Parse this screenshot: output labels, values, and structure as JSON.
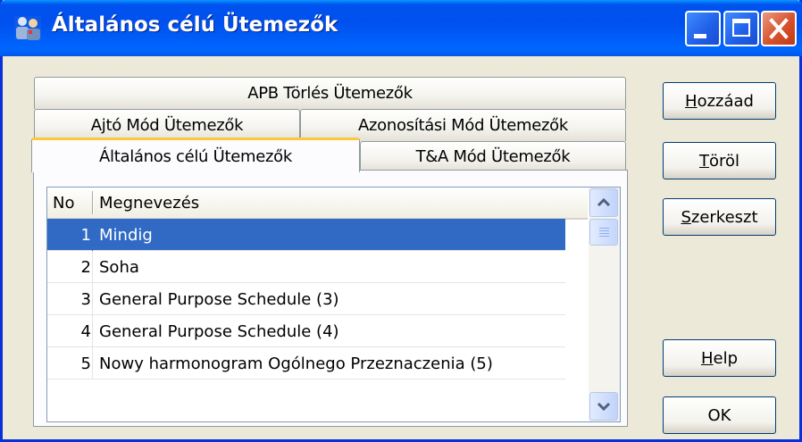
{
  "window": {
    "title": "Általános célú Ütemezők"
  },
  "tabs": [
    {
      "label": "APB Törlés Ütemezők"
    },
    {
      "label": "Ajtó Mód Ütemezők"
    },
    {
      "label": "Azonosítási Mód Ütemezők"
    },
    {
      "label": "Általános célú Ütemezők",
      "active": true
    },
    {
      "label": "T&A Mód Ütemezők"
    }
  ],
  "list": {
    "columns": {
      "no": "No",
      "name": "Megnevezés"
    },
    "rows": [
      {
        "no": "1",
        "name": "Mindig",
        "selected": true
      },
      {
        "no": "2",
        "name": "Soha"
      },
      {
        "no": "3",
        "name": "General Purpose Schedule (3)"
      },
      {
        "no": "4",
        "name": "General Purpose Schedule (4)"
      },
      {
        "no": "5",
        "name": "Nowy harmonogram Ogólnego Przeznaczenia (5)"
      }
    ]
  },
  "buttons": {
    "add": {
      "accel": "H",
      "rest": "ozzáad"
    },
    "delete": {
      "accel": "T",
      "rest": "öröl"
    },
    "edit": {
      "accel": "S",
      "rest": "zerkeszt"
    },
    "help": {
      "accel": "H",
      "rest": "elp"
    },
    "ok": "OK"
  },
  "icons": {
    "app": "people-icon",
    "minimize": "minimize-icon",
    "maximize": "maximize-icon",
    "close": "close-icon",
    "scroll_up": "chevron-up-icon",
    "scroll_down": "chevron-down-icon"
  },
  "colors": {
    "titlebar": "#0054e3",
    "selection": "#316ac5",
    "tab_highlight": "#ffc83c"
  }
}
